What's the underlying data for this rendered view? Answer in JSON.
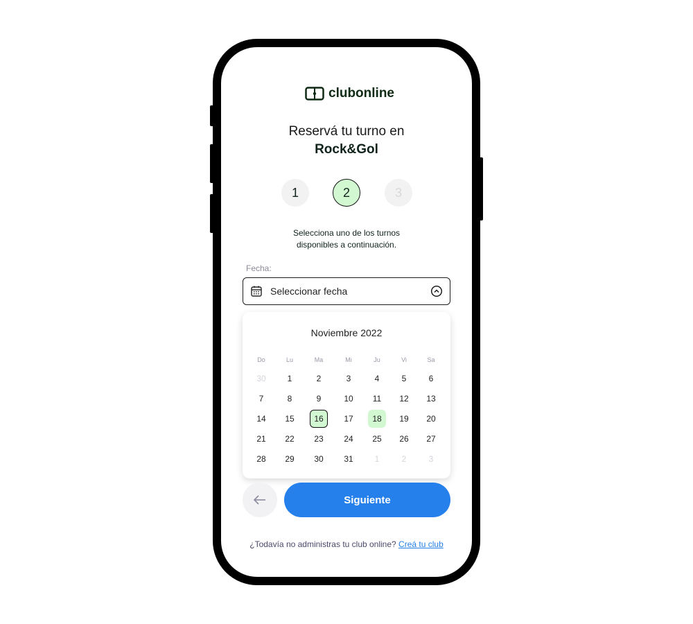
{
  "brand": "clubonline",
  "title": "Reservá tu turno en",
  "club": "Rock&Gol",
  "steps": [
    "1",
    "2",
    "3"
  ],
  "active_step": 2,
  "instructions": [
    "Selecciona uno de los turnos",
    "disponibles a continuación."
  ],
  "date_label": "Fecha:",
  "date_placeholder": "Seleccionar fecha",
  "calendar": {
    "month": "Noviembre 2022",
    "weekdays": [
      "Do",
      "Lu",
      "Ma",
      "Mi",
      "Ju",
      "Vi",
      "Sa"
    ],
    "weeks": [
      [
        "30",
        "1",
        "2",
        "3",
        "4",
        "5",
        "6"
      ],
      [
        "7",
        "8",
        "9",
        "10",
        "11",
        "12",
        "13"
      ],
      [
        "14",
        "15",
        "16",
        "17",
        "18",
        "19",
        "20"
      ],
      [
        "21",
        "22",
        "23",
        "24",
        "25",
        "26",
        "27"
      ],
      [
        "28",
        "29",
        "30",
        "31",
        "1",
        "2",
        "3"
      ]
    ],
    "selected": "16",
    "available": [
      "16",
      "18"
    ]
  },
  "next_label": "Siguiente",
  "footer_text": "¿Todavía no administras tu club online?",
  "footer_link": "Creá tu club",
  "colors": {
    "accent": "#2680eb",
    "available": "#d2f8d2",
    "brand": "#0e2a14"
  }
}
